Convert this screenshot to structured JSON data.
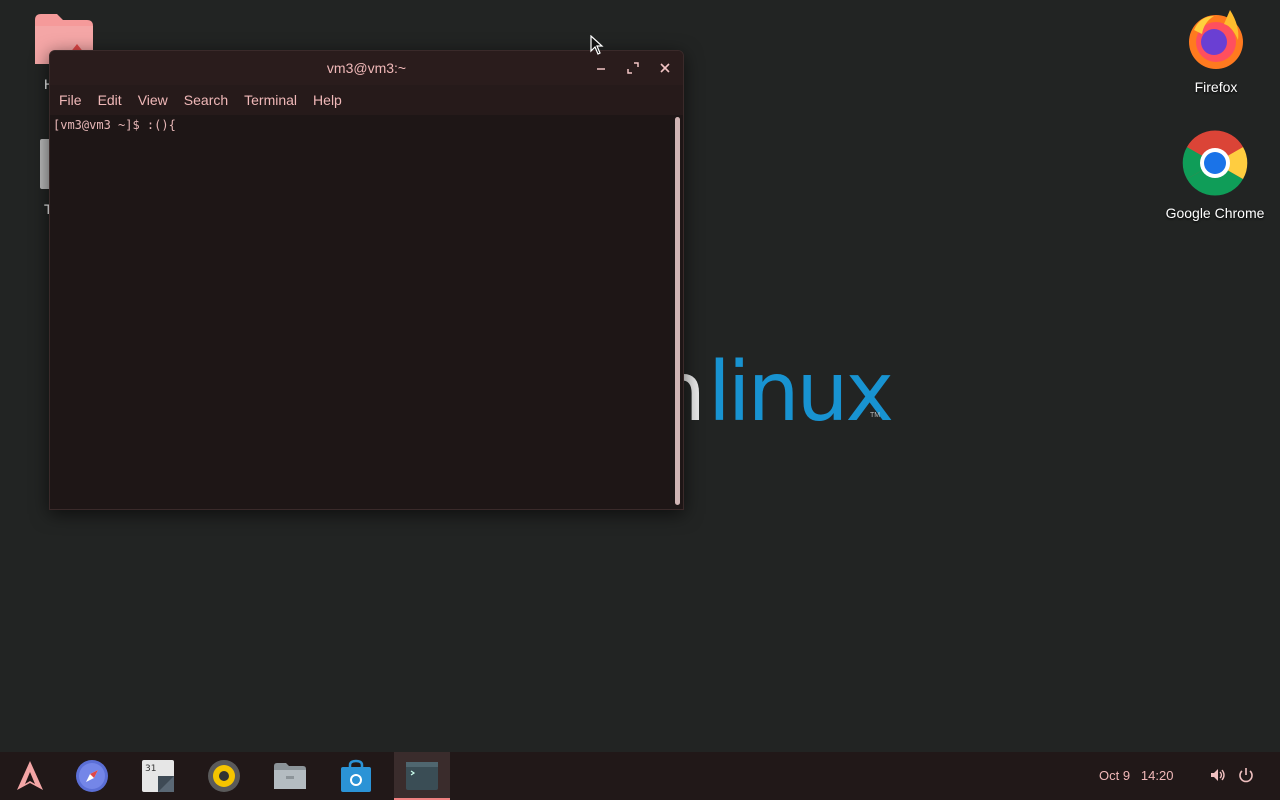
{
  "desktop": {
    "logo_partial": "n",
    "logo_text": "linux",
    "logo_tm": "TM",
    "icons": [
      {
        "label": "Firefox"
      },
      {
        "label": "Google Chrome"
      }
    ],
    "left_partial_labels": [
      "H",
      "T"
    ]
  },
  "terminal": {
    "title": "vm3@vm3:~",
    "menu": [
      "File",
      "Edit",
      "View",
      "Search",
      "Terminal",
      "Help"
    ],
    "prompt_line": "[vm3@vm3 ~]$ :(){"
  },
  "taskbar": {
    "date": "Oct 9",
    "time": "14:20",
    "colors": {
      "accent": "#f08080",
      "background": "#211818"
    }
  }
}
